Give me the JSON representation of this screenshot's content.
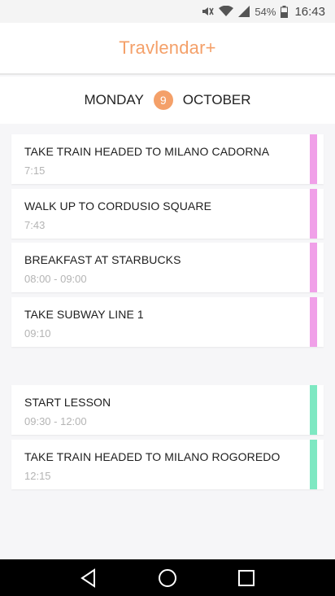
{
  "status_bar": {
    "battery": "54%",
    "time": "16:43"
  },
  "app": {
    "title": "Travlendar+"
  },
  "date": {
    "day_name": "MONDAY",
    "day_number": "9",
    "month": "OCTOBER"
  },
  "colors": {
    "accent": "#f4a069",
    "travel_stripe": "#f0a0e8",
    "event_stripe": "#7ee8c2"
  },
  "events": [
    {
      "title": "TAKE TRAIN HEADED TO MILANO CADORNA",
      "time": "7:15"
    },
    {
      "title": "WALK UP TO CORDUSIO SQUARE",
      "time": "7:43"
    },
    {
      "title": "BREAKFAST AT STARBUCKS",
      "time": "08:00 - 09:00"
    },
    {
      "title": "TAKE SUBWAY LINE 1",
      "time": "09:10"
    },
    {
      "title": "START LESSON",
      "time": "09:30 - 12:00"
    },
    {
      "title": "TAKE TRAIN HEADED TO MILANO ROGOREDO",
      "time": "12:15"
    }
  ]
}
